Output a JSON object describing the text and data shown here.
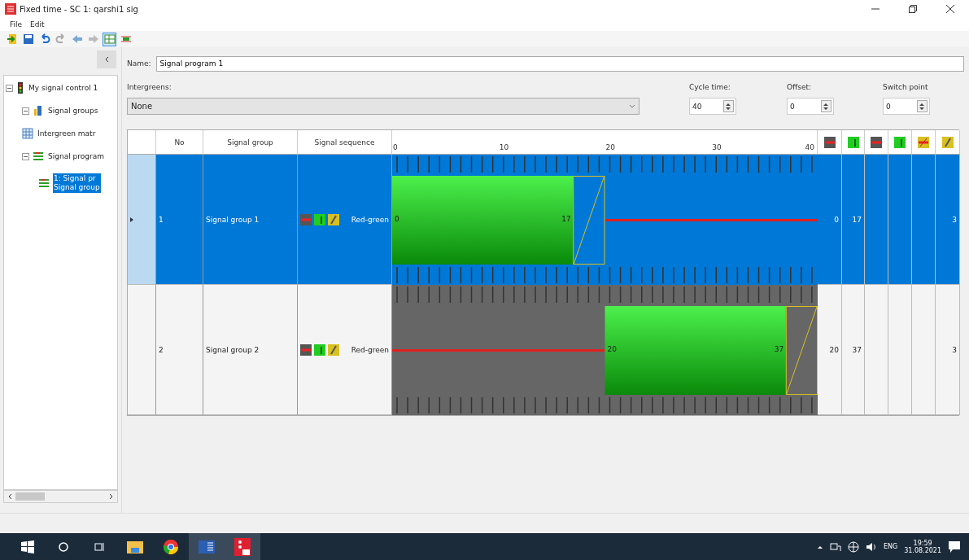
{
  "window": {
    "title": "Fixed time - SC 1: qarshi1 sig"
  },
  "menu": [
    "File",
    "Edit"
  ],
  "toolbar": [
    {
      "kind": "exit",
      "selected": false
    },
    {
      "kind": "save",
      "selected": false
    },
    {
      "kind": "undo",
      "selected": false
    },
    {
      "kind": "redo",
      "selected": false
    },
    {
      "kind": "back",
      "selected": false
    },
    {
      "kind": "forward",
      "selected": false
    },
    {
      "kind": "view-a",
      "selected": true
    },
    {
      "kind": "view-b",
      "selected": false
    }
  ],
  "tree": [
    {
      "label": "My signal control 1",
      "kind": "signal",
      "expanded": true,
      "selected": false,
      "children": [
        {
          "label": "Signal groups",
          "kind": "group",
          "expanded": true,
          "selected": false
        },
        {
          "label": "Intergreen matr",
          "kind": "matrix",
          "selected": false
        },
        {
          "label": "Signal program",
          "kind": "program",
          "expanded": true,
          "selected": false,
          "children": [
            {
              "lines": [
                "1: Signal pr",
                "Signal group"
              ],
              "kind": "program",
              "selected": true
            }
          ]
        }
      ]
    }
  ],
  "form": {
    "name": {
      "label": "Name:",
      "value": "Signal program 1"
    },
    "intergreens": {
      "label": "Intergreens:",
      "value": "None"
    },
    "cycle_time": {
      "label": "Cycle time:",
      "value": "40"
    },
    "offset": {
      "label": "Offset:",
      "value": "0"
    },
    "switch_point": {
      "label": "Switch point",
      "value": "0"
    }
  },
  "table": {
    "columns": [
      "No",
      "Signal group",
      "Signal sequence"
    ],
    "time_ticks": [
      "0",
      "10",
      "20",
      "30",
      "40"
    ],
    "extra_columns": [
      {
        "kind": "red"
      },
      {
        "kind": "green"
      },
      {
        "kind": "red"
      },
      {
        "kind": "green"
      },
      {
        "kind": "redamber"
      },
      {
        "kind": "amber"
      }
    ],
    "rows": [
      {
        "no": "1",
        "group": "Signal group 1",
        "sequence": "Red-green",
        "selected": true,
        "bar_start": "0",
        "bar_end": "17",
        "column_1": "0",
        "column_2": "17",
        "column_6": "3"
      },
      {
        "no": "2",
        "group": "Signal group 2",
        "sequence": "Red-green",
        "selected": false,
        "bar_start": "20",
        "bar_end": "37",
        "column_1": "20",
        "column_2": "37",
        "column_6": "3"
      }
    ]
  },
  "taskbar": {
    "language": "ENG",
    "time": "19:59",
    "date": "31.08.2021"
  }
}
